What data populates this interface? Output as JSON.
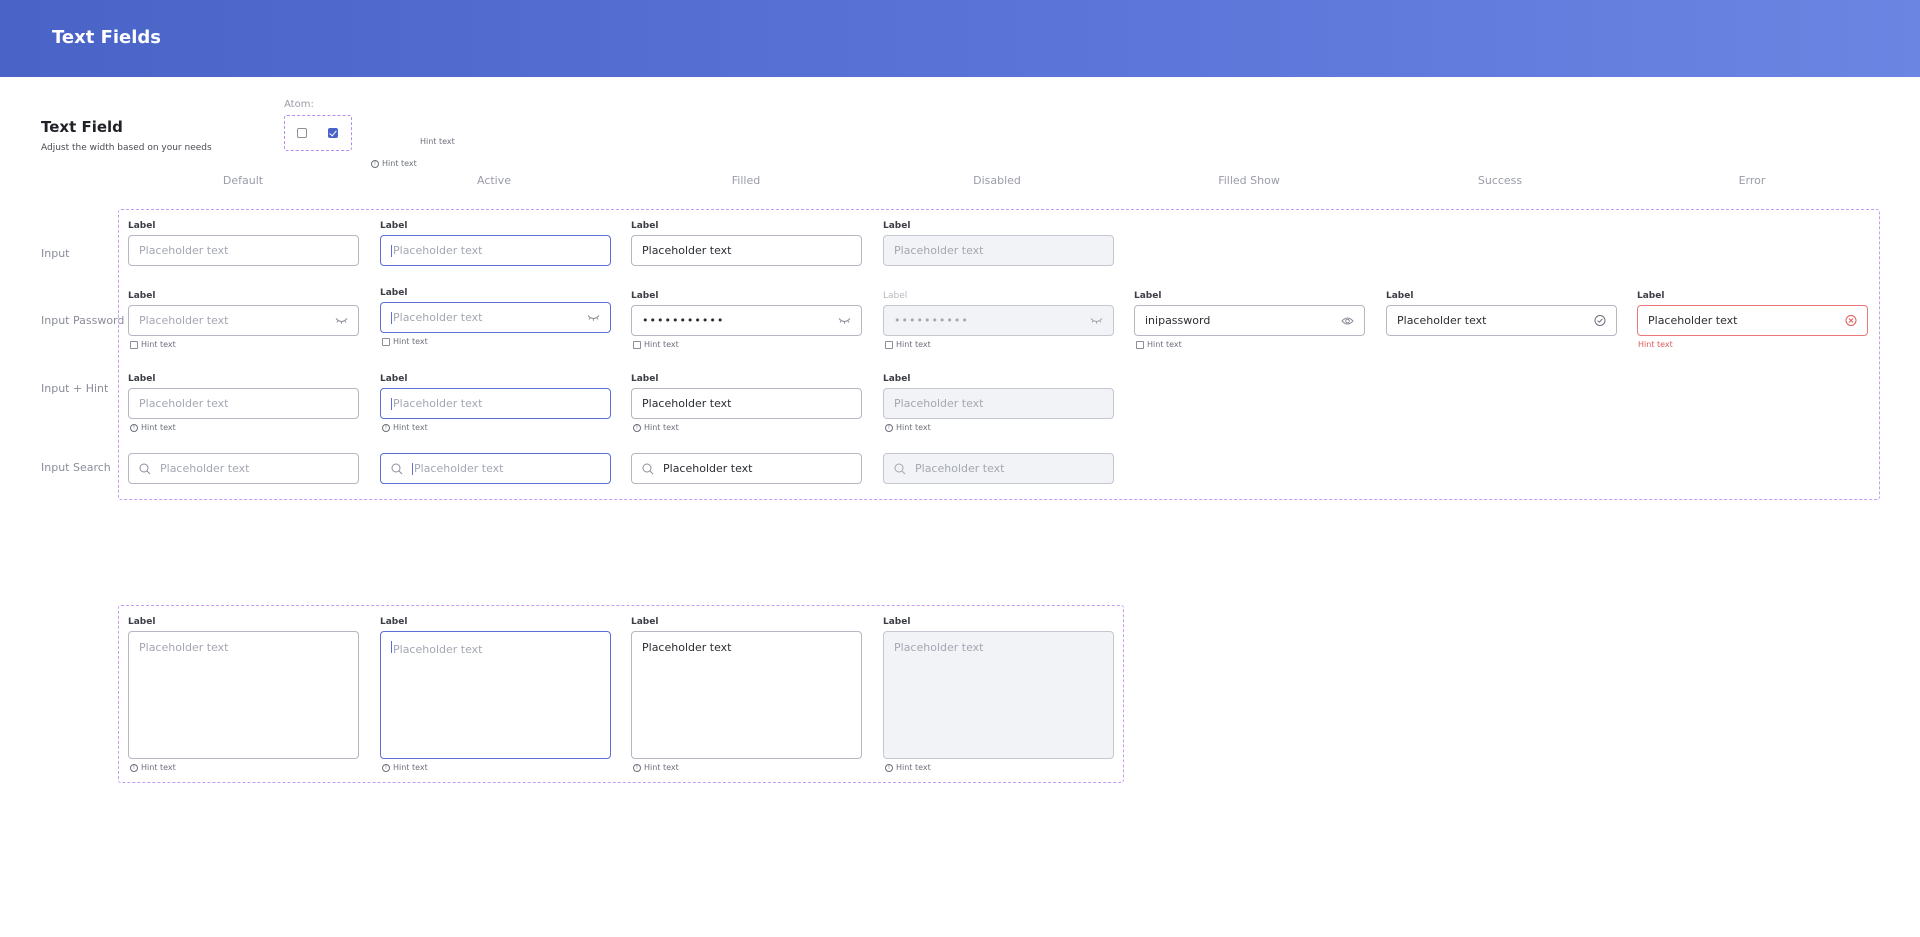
{
  "header": {
    "title": "Text Fields"
  },
  "section": {
    "title": "Text Field",
    "subtitle": "Adjust the width based on your needs"
  },
  "atom": {
    "label": "Atom:",
    "hint1": "Hint text",
    "hint2": "Hint text"
  },
  "columns": [
    "Default",
    "Active",
    "Filled",
    "Disabled",
    "Filled Show",
    "Success",
    "Error"
  ],
  "rows": [
    "Input",
    "Input Password",
    "Input + Hint",
    "Input Search"
  ],
  "field": {
    "label": "Label",
    "placeholder": "Placeholder text",
    "filled_value": "Placeholder text",
    "password_mask": "•••••••••••",
    "password_mask_disabled": "••••••••••",
    "password_shown": "inipassword",
    "hint": "Hint text"
  },
  "colors": {
    "accent": "#5b6fd6",
    "error": "#e97878",
    "frame": "#c49cf2",
    "header_start": "#4a63c6",
    "header_end": "#6a85e2"
  }
}
